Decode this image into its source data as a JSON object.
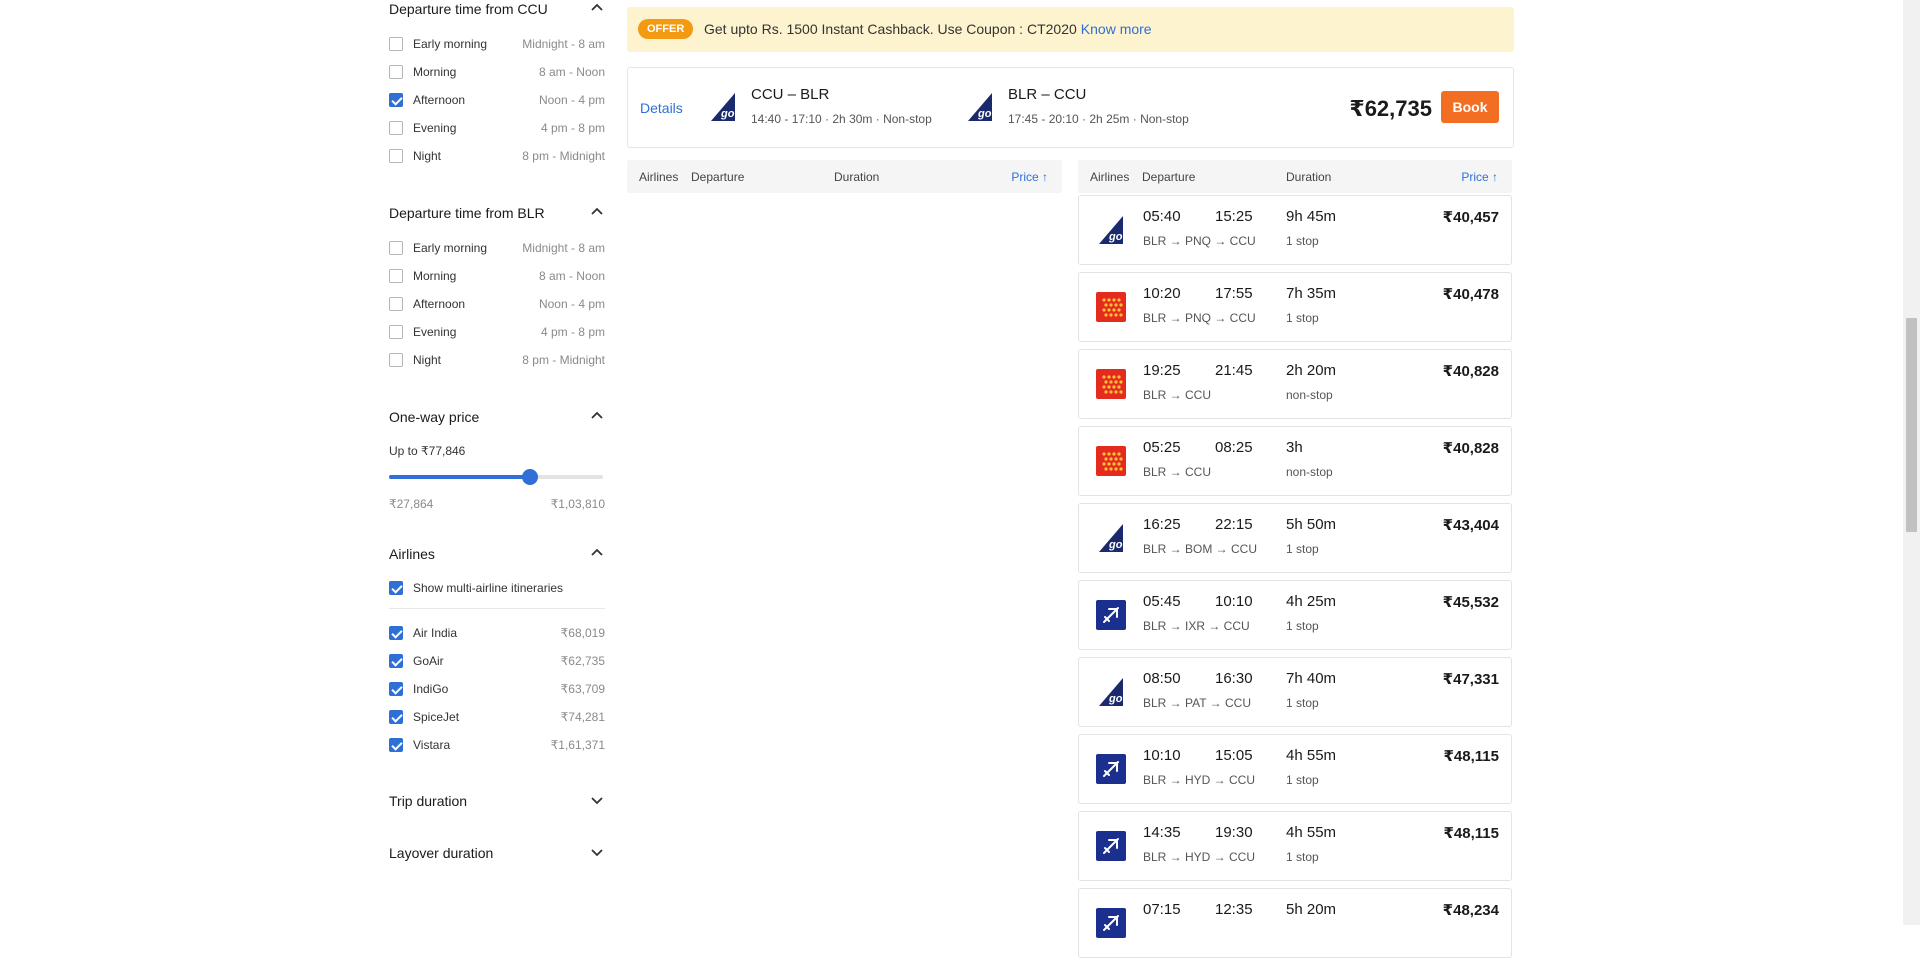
{
  "filters": {
    "dep_ccu": {
      "title": "Departure time from CCU",
      "options": [
        {
          "label": "Early morning",
          "range": "Midnight - 8 am",
          "checked": false
        },
        {
          "label": "Morning",
          "range": "8 am - Noon",
          "checked": false
        },
        {
          "label": "Afternoon",
          "range": "Noon - 4 pm",
          "checked": true
        },
        {
          "label": "Evening",
          "range": "4 pm - 8 pm",
          "checked": false
        },
        {
          "label": "Night",
          "range": "8 pm - Midnight",
          "checked": false
        }
      ]
    },
    "dep_blr": {
      "title": "Departure time from BLR",
      "options": [
        {
          "label": "Early morning",
          "range": "Midnight - 8 am",
          "checked": false
        },
        {
          "label": "Morning",
          "range": "8 am - Noon",
          "checked": false
        },
        {
          "label": "Afternoon",
          "range": "Noon - 4 pm",
          "checked": false
        },
        {
          "label": "Evening",
          "range": "4 pm - 8 pm",
          "checked": false
        },
        {
          "label": "Night",
          "range": "8 pm - Midnight",
          "checked": false
        }
      ]
    },
    "price": {
      "title": "One-way price",
      "current": "Up to ₹77,846",
      "min": "₹27,864",
      "max": "₹1,03,810",
      "fraction": 0.657
    },
    "airlines": {
      "title": "Airlines",
      "multi_label": "Show multi-airline itineraries",
      "multi_checked": true,
      "items": [
        {
          "name": "Air India",
          "price": "₹68,019",
          "checked": true
        },
        {
          "name": "GoAir",
          "price": "₹62,735",
          "checked": true
        },
        {
          "name": "IndiGo",
          "price": "₹63,709",
          "checked": true
        },
        {
          "name": "SpiceJet",
          "price": "₹74,281",
          "checked": true
        },
        {
          "name": "Vistara",
          "price": "₹1,61,371",
          "checked": true
        }
      ]
    },
    "trip_duration": "Trip duration",
    "layover_duration": "Layover duration"
  },
  "offer": {
    "badge": "OFFER",
    "text": "Get upto Rs. 1500 Instant Cashback. Use Coupon : CT2020",
    "link": "Know more"
  },
  "summary": {
    "details": "Details",
    "outbound": {
      "route": "CCU – BLR",
      "meta": "14:40 - 17:10 · 2h 30m · Non-stop",
      "airline": "GoAir"
    },
    "return": {
      "route": "BLR – CCU",
      "meta": "17:45 - 20:10 · 2h 25m · Non-stop",
      "airline": "GoAir"
    },
    "total": "₹62,735",
    "book": "Book"
  },
  "columns": {
    "airlines": "Airlines",
    "departure": "Departure",
    "duration": "Duration",
    "price": "Price ↑"
  },
  "return_flights": [
    {
      "airline": "GoAir",
      "dep": "05:40",
      "arr": "15:25",
      "route": "BLR → PNQ → CCU",
      "duration": "9h 45m",
      "stops": "1 stop",
      "price": "₹40,457"
    },
    {
      "airline": "SpiceJet",
      "dep": "10:20",
      "arr": "17:55",
      "route": "BLR → PNQ → CCU",
      "duration": "7h 35m",
      "stops": "1 stop",
      "price": "₹40,478"
    },
    {
      "airline": "SpiceJet",
      "dep": "19:25",
      "arr": "21:45",
      "route": "BLR → CCU",
      "duration": "2h 20m",
      "stops": "non-stop",
      "price": "₹40,828"
    },
    {
      "airline": "SpiceJet",
      "dep": "05:25",
      "arr": "08:25",
      "route": "BLR → CCU",
      "duration": "3h",
      "stops": "non-stop",
      "price": "₹40,828"
    },
    {
      "airline": "GoAir",
      "dep": "16:25",
      "arr": "22:15",
      "route": "BLR → BOM → CCU",
      "duration": "5h 50m",
      "stops": "1 stop",
      "price": "₹43,404"
    },
    {
      "airline": "IndiGo",
      "dep": "05:45",
      "arr": "10:10",
      "route": "BLR → IXR → CCU",
      "duration": "4h 25m",
      "stops": "1 stop",
      "price": "₹45,532"
    },
    {
      "airline": "GoAir",
      "dep": "08:50",
      "arr": "16:30",
      "route": "BLR → PAT → CCU",
      "duration": "7h 40m",
      "stops": "1 stop",
      "price": "₹47,331"
    },
    {
      "airline": "IndiGo",
      "dep": "10:10",
      "arr": "15:05",
      "route": "BLR → HYD → CCU",
      "duration": "4h 55m",
      "stops": "1 stop",
      "price": "₹48,115"
    },
    {
      "airline": "IndiGo",
      "dep": "14:35",
      "arr": "19:30",
      "route": "BLR → HYD → CCU",
      "duration": "4h 55m",
      "stops": "1 stop",
      "price": "₹48,115"
    },
    {
      "airline": "IndiGo",
      "dep": "07:15",
      "arr": "12:35",
      "route": "",
      "duration": "5h 20m",
      "stops": "",
      "price": "₹48,234"
    }
  ]
}
